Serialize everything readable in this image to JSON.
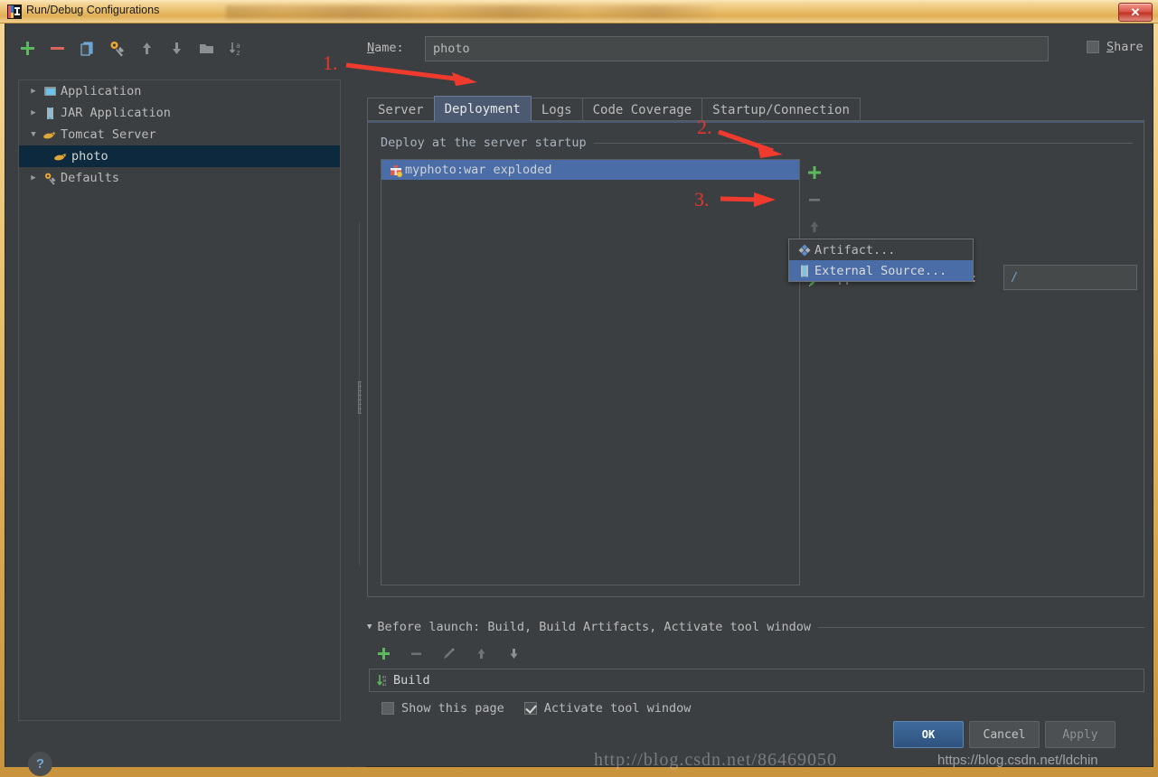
{
  "window": {
    "title": "Run/Debug Configurations",
    "close_label": "✕",
    "app_icon": "intellij-idea-icon"
  },
  "sidebar": {
    "toolbar": [
      {
        "name": "add-configuration-button",
        "icon": "plus-icon",
        "label": "+"
      },
      {
        "name": "remove-configuration-button",
        "icon": "minus-icon",
        "label": "−"
      },
      {
        "name": "copy-configuration-button",
        "icon": "copy-icon",
        "label": ""
      },
      {
        "name": "edit-defaults-button",
        "icon": "gear-wrench-icon",
        "label": ""
      },
      {
        "name": "move-up-button",
        "icon": "arrow-up-icon",
        "label": ""
      },
      {
        "name": "move-down-button",
        "icon": "arrow-down-icon",
        "label": ""
      },
      {
        "name": "new-folder-button",
        "icon": "folder-icon",
        "label": ""
      },
      {
        "name": "sort-configurations-button",
        "icon": "sort-az-icon",
        "label": ""
      }
    ],
    "tree": [
      {
        "label": "Application",
        "icon": "application-icon",
        "expanded": false,
        "child": false,
        "selected": false,
        "arrow": "▶"
      },
      {
        "label": "JAR Application",
        "icon": "jar-icon",
        "expanded": false,
        "child": false,
        "selected": false,
        "arrow": "▶"
      },
      {
        "label": "Tomcat Server",
        "icon": "tomcat-icon",
        "expanded": true,
        "child": false,
        "selected": false,
        "arrow": "▼"
      },
      {
        "label": "photo",
        "icon": "tomcat-icon",
        "expanded": false,
        "child": true,
        "selected": true,
        "arrow": ""
      },
      {
        "label": "Defaults",
        "icon": "gear-wrench-icon",
        "expanded": false,
        "child": false,
        "selected": false,
        "arrow": "▶"
      }
    ],
    "help_label": "?"
  },
  "main": {
    "name_label_pre": "N",
    "name_label_underlined": "N",
    "name_label": "Name:",
    "name_value": "photo",
    "name_placeholder": "",
    "share_label": "Share",
    "share_checked": false,
    "tabs": [
      {
        "label": "Server",
        "active": false
      },
      {
        "label": "Deployment",
        "active": true
      },
      {
        "label": "Logs",
        "active": false
      },
      {
        "label": "Code Coverage",
        "active": false
      },
      {
        "label": "Startup/Connection",
        "active": false
      }
    ],
    "deploy_group_title": "Deploy at the server startup",
    "deploy_items": [
      {
        "label": "myphoto:war exploded",
        "icon": "artifact-gift-icon",
        "selected": true
      }
    ],
    "deploy_toolbar": [
      {
        "name": "add-deployment-button",
        "icon": "plus-icon"
      },
      {
        "name": "remove-deployment-button",
        "icon": "minus-icon"
      },
      {
        "name": "move-deployment-up-button",
        "icon": "arrow-up-icon"
      },
      {
        "name": "move-deployment-down-button",
        "icon": "arrow-down-icon"
      },
      {
        "name": "edit-deployment-button",
        "icon": "pencil-icon"
      }
    ],
    "app_context_label": "Application context:",
    "app_context_value": "/",
    "app_context_arrow": "▼",
    "popup_menu": [
      {
        "label": "Artifact...",
        "icon": "artifact-diamond-icon",
        "selected": false
      },
      {
        "label": "External Source...",
        "icon": "external-source-icon",
        "selected": true
      }
    ]
  },
  "before_launch": {
    "triangle": "▼",
    "header": "Before launch: Build, Build Artifacts, Activate tool window",
    "header_underlined_first": "B",
    "toolbar": [
      {
        "name": "add-before-launch-task-button",
        "icon": "plus-icon"
      },
      {
        "name": "remove-before-launch-task-button",
        "icon": "minus-icon"
      },
      {
        "name": "edit-before-launch-task-button",
        "icon": "pencil-icon"
      },
      {
        "name": "move-task-up-button",
        "icon": "arrow-up-icon"
      },
      {
        "name": "move-task-down-button",
        "icon": "arrow-down-icon"
      }
    ],
    "tasks": [
      {
        "label": "Build",
        "icon": "build-icon"
      }
    ],
    "show_page_label": "Show this page",
    "show_page_checked": false,
    "activate_tool_window_label": "Activate tool window",
    "activate_tool_window_checked": true
  },
  "footer": {
    "buttons": [
      {
        "label": "OK",
        "name": "ok-button",
        "style": "primary"
      },
      {
        "label": "Cancel",
        "name": "cancel-button",
        "style": "normal"
      },
      {
        "label": "Apply",
        "name": "apply-button",
        "style": "disabled"
      }
    ]
  },
  "annotations": [
    {
      "number": "1.",
      "target": "deployment-tab"
    },
    {
      "number": "2.",
      "target": "add-deployment-button"
    },
    {
      "number": "3.",
      "target": "external-source-menu-item"
    }
  ],
  "watermarks": {
    "primary": "http://blog.csdn.net/86469050",
    "secondary": "https://blog.csdn.net/ldchin"
  },
  "colors": {
    "window_chrome": "#e8bd6a",
    "dialog_bg": "#3c3f41",
    "selection_blue": "#4a6da7",
    "tree_selection": "#0d293e",
    "active_tab": "#4b5a70",
    "accent_green": "#4caf50",
    "annotation_red": "#e8352a",
    "link_blue": "#6d9ec9"
  }
}
